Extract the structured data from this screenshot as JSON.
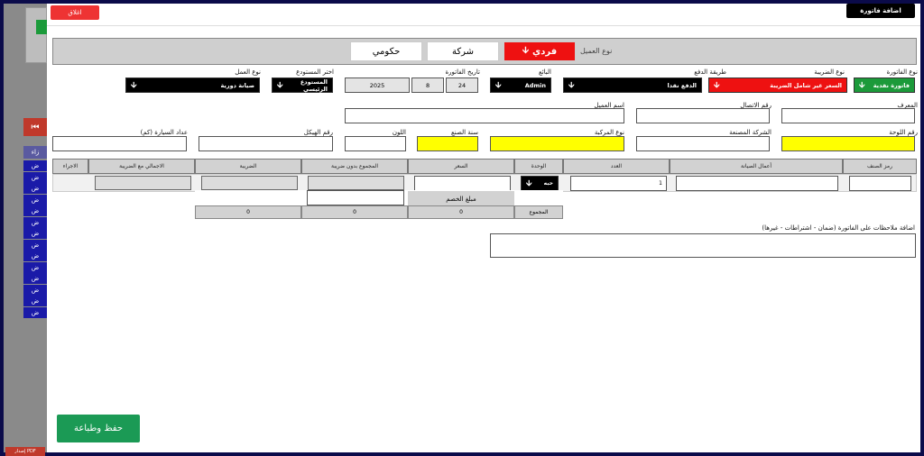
{
  "background": {
    "top_button": "",
    "pdf_label": "إصدار PDF",
    "list_items": [
      "ض",
      "ض",
      "ض",
      "ض",
      "ض",
      "ض",
      "ض",
      "ض",
      "ض",
      "ض",
      "ض",
      "ض",
      "ض",
      "ض"
    ],
    "list_header": "زاء"
  },
  "modal": {
    "title": "اضافة فاتورة",
    "close_label": "اغلاق",
    "customer_type_label": "نوع العميل",
    "customer_types": {
      "individual": "فردي",
      "company": "شركة",
      "government": "حكومي"
    },
    "fields": {
      "invoice_type": {
        "label": "نوع الفاتورة",
        "value": "فاتورة نقدية"
      },
      "tax_type": {
        "label": "نوع الضريبة",
        "value": "السعر غير شامل الضريبة"
      },
      "payment_method": {
        "label": "طريقة الدفع",
        "value": "الدفع نقدا"
      },
      "seller": {
        "label": "البائع",
        "value": "Admin"
      },
      "invoice_date": {
        "label": "تاريخ الفاتورة",
        "day": "24",
        "month": "8",
        "year": "2025"
      },
      "warehouse": {
        "label": "اختر المستودع",
        "value": "المستودع الرئيسي"
      },
      "work_type": {
        "label": "نوع العمل",
        "value": "صيانة دورية"
      },
      "identifier": {
        "label": "المعرف",
        "value": ""
      },
      "phone": {
        "label": "رقم الاتصال",
        "value": ""
      },
      "customer_name": {
        "label": "اسم العميل",
        "value": ""
      },
      "plate_number": {
        "label": "رقم اللوحة",
        "value": ""
      },
      "manufacturer": {
        "label": "الشركة المصنعة",
        "value": ""
      },
      "vehicle_type": {
        "label": "نوع المركبة",
        "value": ""
      },
      "year": {
        "label": "سنة الصنع",
        "value": ""
      },
      "color": {
        "label": "اللون",
        "value": ""
      },
      "chassis": {
        "label": "رقم الهيكل",
        "value": ""
      },
      "odometer": {
        "label": "عداد السيارة (كم)",
        "value": ""
      }
    },
    "table": {
      "headers": {
        "item_code": "رمز الصنف",
        "maintenance": "أعمال الصيانة",
        "quantity": "العدد",
        "unit": "الوحدة",
        "price": "السعر",
        "subtotal": "المجموع بدون ضريبة",
        "tax": "الضريبة",
        "total_with_tax": "الاجمالي مع الضريبة",
        "action": "الاجراء"
      },
      "row": {
        "quantity": "1",
        "unit": "حبه"
      },
      "discount_label": "مبلغ الخصم",
      "sum_label": "المجموع",
      "sum_values": {
        "subtotal": "0",
        "tax": "0",
        "total": "0"
      }
    },
    "notes_label": "اضافة ملاحظات على الفاتورة (ضمان - اشتراطات - غيرها)",
    "save_label": "حفظ وطباعة"
  },
  "colors": {
    "frame": "#0b0b4a",
    "green": "#1b9a3a",
    "red": "#ee1111",
    "yellow": "#ffff00"
  }
}
